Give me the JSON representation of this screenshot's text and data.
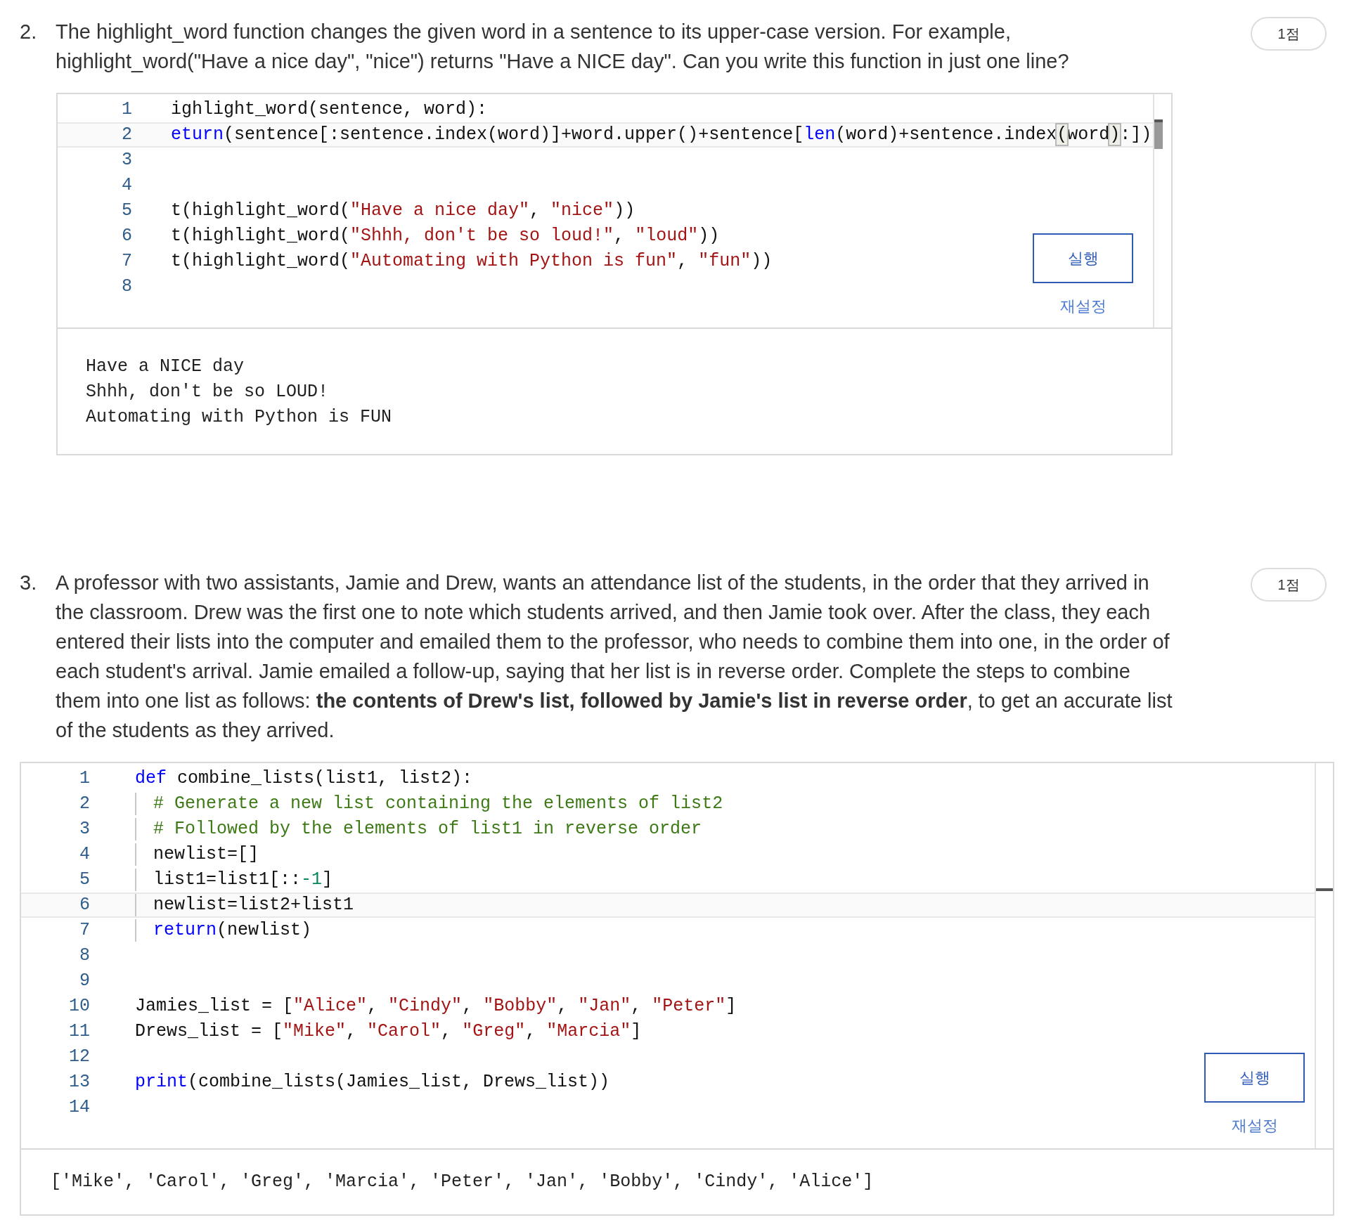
{
  "questions": [
    {
      "number": "2.",
      "points": "1점",
      "prompt": "The highlight_word function changes the given word in a sentence to its upper-case version. For example, highlight_word(\"Have a nice day\", \"nice\") returns \"Have a NICE day\". Can you write this function in just one line?",
      "editor": {
        "run_button": "실행",
        "reset_link": "재설정",
        "lines": [
          {
            "number": "1",
            "active": false,
            "tokens": [
              {
                "kind": "plain",
                "text": "ighlight_word(sentence, word):"
              }
            ]
          },
          {
            "number": "2",
            "active": true,
            "tokens": [
              {
                "kind": "keyword",
                "text": "eturn"
              },
              {
                "kind": "plain",
                "text": "(sentence[:sentence.index(word)]+word.upper()+sentence["
              },
              {
                "kind": "keyword",
                "text": "len"
              },
              {
                "kind": "plain",
                "text": "(word)+sentence.index"
              },
              {
                "kind": "bracket",
                "text": "("
              },
              {
                "kind": "plain",
                "text": "word"
              },
              {
                "kind": "bracket",
                "text": ")"
              },
              {
                "kind": "plain",
                "text": ":])"
              }
            ]
          },
          {
            "number": "3",
            "active": false
          },
          {
            "number": "4",
            "active": false
          },
          {
            "number": "5",
            "active": false,
            "tokens": [
              {
                "kind": "plain",
                "text": "t(highlight_word("
              },
              {
                "kind": "string",
                "text": "\"Have a nice day\""
              },
              {
                "kind": "plain",
                "text": ", "
              },
              {
                "kind": "string",
                "text": "\"nice\""
              },
              {
                "kind": "plain",
                "text": "))"
              }
            ]
          },
          {
            "number": "6",
            "active": false,
            "tokens": [
              {
                "kind": "plain",
                "text": "t(highlight_word("
              },
              {
                "kind": "string",
                "text": "\"Shhh, don't be so loud!\""
              },
              {
                "kind": "plain",
                "text": ", "
              },
              {
                "kind": "string",
                "text": "\"loud\""
              },
              {
                "kind": "plain",
                "text": "))"
              }
            ]
          },
          {
            "number": "7",
            "active": false,
            "tokens": [
              {
                "kind": "plain",
                "text": "t(highlight_word("
              },
              {
                "kind": "string",
                "text": "\"Automating with Python is fun\""
              },
              {
                "kind": "plain",
                "text": ", "
              },
              {
                "kind": "string",
                "text": "\"fun\""
              },
              {
                "kind": "plain",
                "text": "))"
              }
            ]
          },
          {
            "number": "8",
            "active": false
          }
        ],
        "output": [
          "Have a NICE day",
          "Shhh, don't be so LOUD!",
          "Automating with Python is FUN"
        ]
      }
    },
    {
      "number": "3.",
      "points": "1점",
      "prompt": "A professor with two assistants, Jamie and Drew, wants an attendance list of the students, in the order that they arrived in the classroom. Drew was the first one to note which students arrived, and then Jamie took over. After the class, they each entered their lists into the computer and emailed them to the professor, who needs to combine them into one, in the order of each student's arrival. Jamie emailed a follow-up, saying that her list is in reverse order. Complete the steps to combine them into one list as follows: **the contents of Drew's list, followed by Jamie's list in reverse order**, to get an accurate list of the students as they arrived.",
      "editor": {
        "run_button": "실행",
        "reset_link": "재설정",
        "lines": [
          {
            "number": "1",
            "active": false,
            "tokens": [
              {
                "kind": "keyword",
                "text": "def"
              },
              {
                "kind": "plain",
                "text": " combine_lists(list1, list2):"
              }
            ],
            "children": [
              {
                "number": "2",
                "active": false,
                "tokens": [
                  {
                    "kind": "comment",
                    "text": "# Generate a new list containing the elements of list2"
                  }
                ]
              },
              {
                "number": "3",
                "active": false,
                "tokens": [
                  {
                    "kind": "comment",
                    "text": "# Followed by the elements of list1 in reverse order"
                  }
                ]
              },
              {
                "number": "4",
                "active": false,
                "tokens": [
                  {
                    "kind": "plain",
                    "text": "newlist=[]"
                  }
                ]
              },
              {
                "number": "5",
                "active": false,
                "tokens": [
                  {
                    "kind": "plain",
                    "text": "list1=list1[::"
                  },
                  {
                    "kind": "number",
                    "text": "-1"
                  },
                  {
                    "kind": "plain",
                    "text": "]"
                  }
                ]
              },
              {
                "number": "6",
                "active": true,
                "tokens": [
                  {
                    "kind": "plain",
                    "text": "newlist=list2+list1"
                  }
                ]
              },
              {
                "number": "7",
                "active": false,
                "tokens": [
                  {
                    "kind": "keyword",
                    "text": "return"
                  },
                  {
                    "kind": "plain",
                    "text": "(newlist)"
                  }
                ]
              }
            ]
          },
          {
            "number": "8",
            "active": false
          },
          {
            "number": "9",
            "active": false
          },
          {
            "number": "10",
            "active": false,
            "tokens": [
              {
                "kind": "plain",
                "text": "Jamies_list = ["
              },
              {
                "kind": "string",
                "text": "\"Alice\""
              },
              {
                "kind": "plain",
                "text": ", "
              },
              {
                "kind": "string",
                "text": "\"Cindy\""
              },
              {
                "kind": "plain",
                "text": ", "
              },
              {
                "kind": "string",
                "text": "\"Bobby\""
              },
              {
                "kind": "plain",
                "text": ", "
              },
              {
                "kind": "string",
                "text": "\"Jan\""
              },
              {
                "kind": "plain",
                "text": ", "
              },
              {
                "kind": "string",
                "text": "\"Peter\""
              },
              {
                "kind": "plain",
                "text": "]"
              }
            ]
          },
          {
            "number": "11",
            "active": false,
            "tokens": [
              {
                "kind": "plain",
                "text": "Drews_list = ["
              },
              {
                "kind": "string",
                "text": "\"Mike\""
              },
              {
                "kind": "plain",
                "text": ", "
              },
              {
                "kind": "string",
                "text": "\"Carol\""
              },
              {
                "kind": "plain",
                "text": ", "
              },
              {
                "kind": "string",
                "text": "\"Greg\""
              },
              {
                "kind": "plain",
                "text": ", "
              },
              {
                "kind": "string",
                "text": "\"Marcia\""
              },
              {
                "kind": "plain",
                "text": "]"
              }
            ]
          },
          {
            "number": "12",
            "active": false
          },
          {
            "number": "13",
            "active": false,
            "tokens": [
              {
                "kind": "keyword",
                "text": "print"
              },
              {
                "kind": "plain",
                "text": "(combine_lists(Jamies_list, Drews_list))"
              }
            ]
          },
          {
            "number": "14",
            "active": false
          }
        ],
        "output": [
          "['Mike', 'Carol', 'Greg', 'Marcia', 'Peter', 'Jan', 'Bobby', 'Cindy', 'Alice']"
        ]
      }
    }
  ]
}
